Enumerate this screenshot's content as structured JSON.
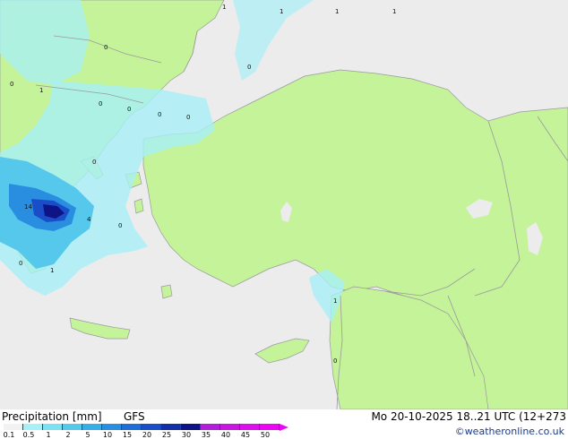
{
  "map": {
    "land_color": "#c4f39a",
    "sea_color": "#ececec",
    "border_color": "#9a9a9a",
    "value_labels": [
      "1",
      "1",
      "1",
      "1",
      "0",
      "0",
      "0",
      "1",
      "0",
      "0",
      "0",
      "0",
      "0",
      "14",
      "4",
      "0",
      "0",
      "1",
      "1",
      "0"
    ]
  },
  "footer": {
    "title": "Precipitation [mm]",
    "model": "GFS",
    "date": "Mo 20-10-2025 18..21 UTC (12+273",
    "credit": "©weatheronline.co.uk"
  },
  "legend": {
    "ticks": [
      "0.1",
      "0.5",
      "1",
      "2",
      "5",
      "10",
      "15",
      "20",
      "25",
      "30",
      "35",
      "40",
      "45",
      "50"
    ],
    "colors": [
      "#f2f2f2",
      "#a8f0f8",
      "#7be0f0",
      "#56c8ec",
      "#38aee8",
      "#2a8ee0",
      "#1e6ed6",
      "#1a4ec8",
      "#1430a8",
      "#0e1486",
      "#b020d8",
      "#c818e0",
      "#dc10ec",
      "#ea08f4"
    ]
  }
}
